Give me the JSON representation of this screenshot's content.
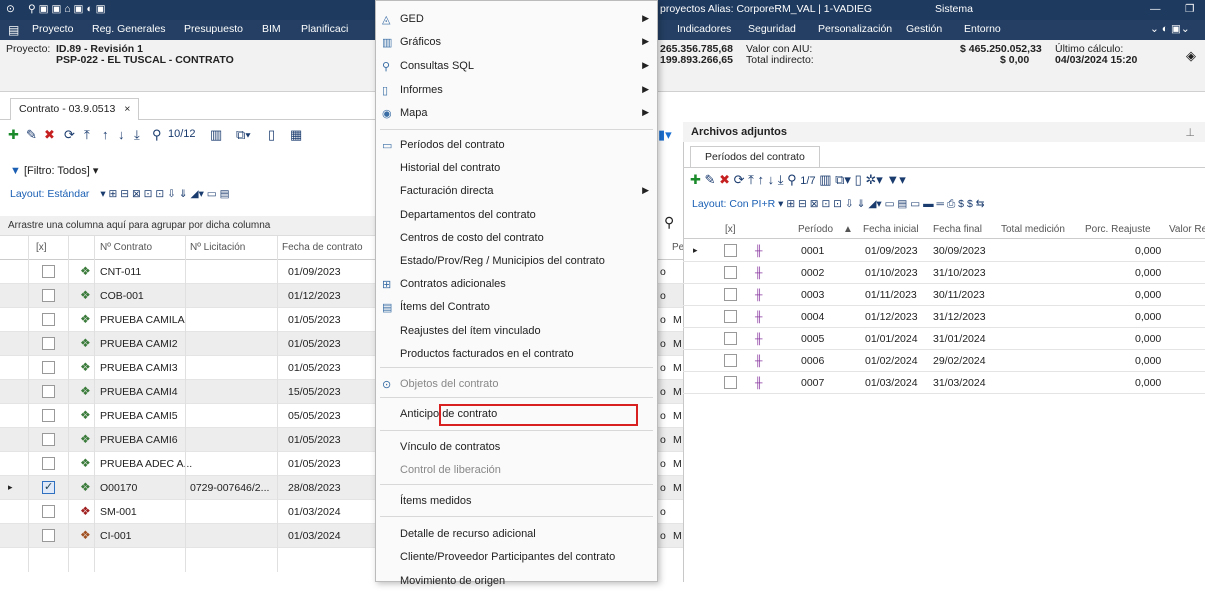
{
  "titlebar": {
    "system": "Sistema",
    "window_text": "proyectos Alias: CorporeRM_VAL | 1-VADIEG"
  },
  "menubar": {
    "items": [
      "Proyecto",
      "Reg. Generales",
      "Presupuesto",
      "BIM",
      "Planificaci",
      "Indicadores",
      "Seguridad",
      "Personalización",
      "Gestión",
      "Entorno"
    ]
  },
  "project": {
    "label": "Proyecto:",
    "id": "ID.89 - Revisión 1",
    "name": "PSP-022 - EL TUSCAL - CONTRATO",
    "val1": "265.356.785,68",
    "val1_label": "Valor con AIU:",
    "val2": "199.893.266,65",
    "val2_label": "Total indirecto:",
    "val3": "$ 465.250.052,33",
    "val3_label": "Último cálculo:",
    "val4": "$ 0,00",
    "date": "04/03/2024 15:20"
  },
  "tab": {
    "label": "Contrato - 03.9.0513",
    "close": "×"
  },
  "toolbar": {
    "pager": "10/12"
  },
  "filter": {
    "label": "[Filtro: Todos]"
  },
  "layout": {
    "label": "Layout:",
    "value": "Estándar"
  },
  "grid": {
    "group_hint": "Arrastre una columna aquí para agrupar por dicha columna",
    "headers": [
      "[x]",
      "Nº Contrato",
      "Nº Licitación",
      "Fecha de contrato"
    ],
    "rows": [
      {
        "num": "CNT-011",
        "lic": "",
        "fecha": "01/09/2023",
        "c": ""
      },
      {
        "num": "COB-001",
        "lic": "",
        "fecha": "01/12/2023",
        "c": ""
      },
      {
        "num": "PRUEBA CAMILA",
        "lic": "",
        "fecha": "01/05/2023",
        "c": "M"
      },
      {
        "num": "PRUEBA CAMI2",
        "lic": "",
        "fecha": "01/05/2023",
        "c": "M"
      },
      {
        "num": "PRUEBA CAMI3",
        "lic": "",
        "fecha": "01/05/2023",
        "c": "M"
      },
      {
        "num": "PRUEBA CAMI4",
        "lic": "",
        "fecha": "15/05/2023",
        "c": "M"
      },
      {
        "num": "PRUEBA CAMI5",
        "lic": "",
        "fecha": "05/05/2023",
        "c": "M"
      },
      {
        "num": "PRUEBA CAMI6",
        "lic": "",
        "fecha": "01/05/2023",
        "c": "M"
      },
      {
        "num": "PRUEBA ADEC A...",
        "lic": "",
        "fecha": "01/05/2023",
        "c": "M"
      },
      {
        "num": "O00170",
        "lic": "0729-007646/2...",
        "fecha": "28/08/2023",
        "c": "M"
      },
      {
        "num": "SM-001",
        "lic": "",
        "fecha": "01/03/2024",
        "c": ""
      },
      {
        "num": "CI-001",
        "lic": "",
        "fecha": "01/03/2024",
        "c": "M"
      }
    ]
  },
  "menu": {
    "items": [
      "GED",
      "Gráficos",
      "Consultas SQL",
      "Informes",
      "Mapa",
      "Períodos del contrato",
      "Historial del contrato",
      "Facturación directa",
      "Departamentos del contrato",
      "Centros de costo del contrato",
      "Estado/Prov/Reg / Municipios del contrato",
      "Contratos adicionales",
      "Ítems del Contrato",
      "Reajustes del ítem vinculado",
      "Productos facturados en el contrato",
      "Objetos del contrato",
      "Anticipo de contrato",
      "Vínculo de contratos",
      "Control de liberación",
      "Ítems medidos",
      "Detalle de recurso adicional",
      "Cliente/Proveedor Participantes del contrato",
      "Movimiento de origen"
    ]
  },
  "right": {
    "title": "Archivos adjuntos",
    "tab": "Períodos del contrato",
    "pager": "1/7",
    "layout_label": "Layout:",
    "layout_value": "Con PI+R",
    "headers": [
      "[x]",
      "Período",
      "Fecha inicial",
      "Fecha final",
      "Total medición",
      "Porc. Reajuste",
      "Valor Re"
    ],
    "rows": [
      {
        "p": "0001",
        "i": "01/09/2023",
        "f": "30/09/2023",
        "r": "0,000"
      },
      {
        "p": "0002",
        "i": "01/10/2023",
        "f": "31/10/2023",
        "r": "0,000"
      },
      {
        "p": "0003",
        "i": "01/11/2023",
        "f": "30/11/2023",
        "r": "0,000"
      },
      {
        "p": "0004",
        "i": "01/12/2023",
        "f": "31/12/2023",
        "r": "0,000"
      },
      {
        "p": "0005",
        "i": "01/01/2024",
        "f": "31/01/2024",
        "r": "0,000"
      },
      {
        "p": "0006",
        "i": "01/02/2024",
        "f": "29/02/2024",
        "r": "0,000"
      },
      {
        "p": "0007",
        "i": "01/03/2024",
        "f": "31/03/2024",
        "r": "0,000"
      }
    ]
  }
}
